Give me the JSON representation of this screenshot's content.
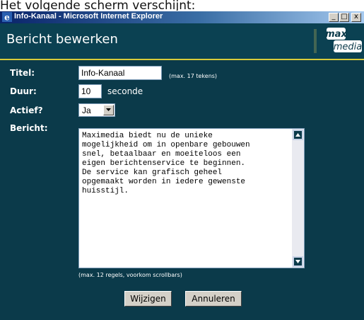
{
  "caption": "Het volgende scherm verschijnt:",
  "window": {
    "title": "Info-Kanaal - Microsoft Internet Explorer",
    "minimize_label": "_",
    "maximize_label": "□",
    "close_label": "x"
  },
  "header": {
    "page_title": "Bericht bewerken",
    "logo_top": "max",
    "logo_bottom": "media"
  },
  "form": {
    "titel_label": "Titel:",
    "titel_value": "Info-Kanaal",
    "titel_hint": "(max. 17 tekens)",
    "duur_label": "Duur:",
    "duur_value": "10",
    "duur_unit": "seconde",
    "actief_label": "Actief?",
    "actief_value": "Ja",
    "bericht_label": "Bericht:",
    "bericht_value": "Maximedia biedt nu de unieke\nmogelijkheid om in openbare gebouwen\nsnel, betaalbaar en moeiteloos een\neigen berichtenservice te beginnen.\nDe service kan grafisch geheel\nopgemaakt worden in iedere gewenste\nhuisstijl.",
    "bericht_hint": "(max. 12 regels, voorkom scrollbars)"
  },
  "buttons": {
    "save_label": "Wijzigen",
    "cancel_label": "Annuleren"
  },
  "colors": {
    "background": "#0b3a4a",
    "header_background": "#0b4152",
    "accent_line": "#d8cc3a"
  },
  "icons": {
    "window": "ie-icon",
    "dropdown": "chevron-down-icon",
    "scroll_up": "triangle-up-icon",
    "scroll_down": "triangle-down-icon"
  }
}
